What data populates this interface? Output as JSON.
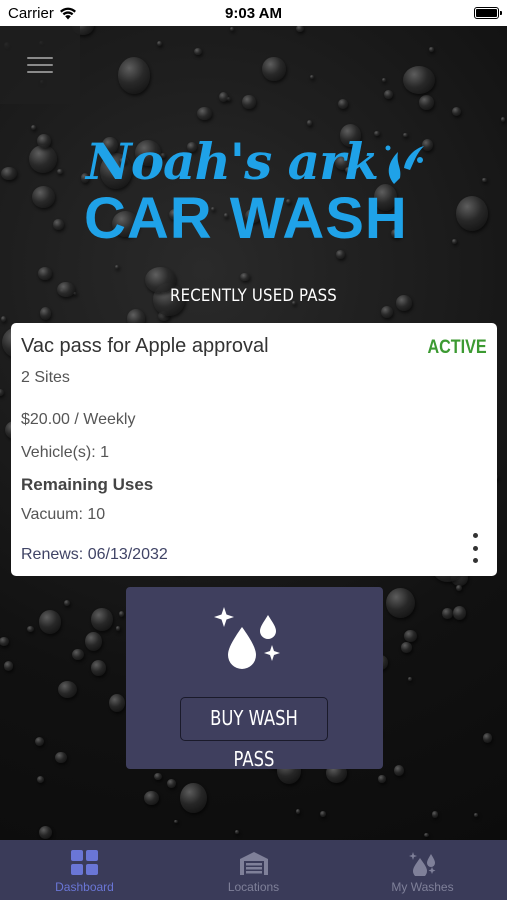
{
  "status_bar": {
    "carrier": "Carrier",
    "time": "9:03 AM",
    "battery_level": 1.0
  },
  "header": {
    "menu_icon": "hamburger-menu-icon"
  },
  "logo": {
    "script_text": "Noah's ark",
    "block_text": "CAR WASH",
    "color": "#1fa2e8"
  },
  "recent": {
    "section_title": "RECENTLY USED PASS",
    "pass": {
      "name": "Vac pass for Apple approval",
      "status": "ACTIVE",
      "status_color": "#3c9a32",
      "sites": "2 Sites",
      "price": "$20.00 / Weekly",
      "vehicles": "Vehicle(s): 1",
      "remaining_title": "Remaining Uses",
      "vacuum": "Vacuum: 10",
      "renews": "Renews: 06/13/2032",
      "more_icon": "vertical-ellipsis-icon"
    }
  },
  "buy": {
    "icon": "wash-drops-sparkle-icon",
    "button_label": "BUY WASH PASS"
  },
  "tabs": [
    {
      "label": "Dashboard",
      "icon": "grid-icon",
      "active": true
    },
    {
      "label": "Locations",
      "icon": "garage-icon",
      "active": false
    },
    {
      "label": "My Washes",
      "icon": "drops-icon",
      "active": false
    }
  ],
  "colors": {
    "tab_bar": "#3a3b59",
    "tab_active": "#6a76d6",
    "tab_inactive": "#7f8099",
    "buy_tile": "#3f3f5e"
  }
}
